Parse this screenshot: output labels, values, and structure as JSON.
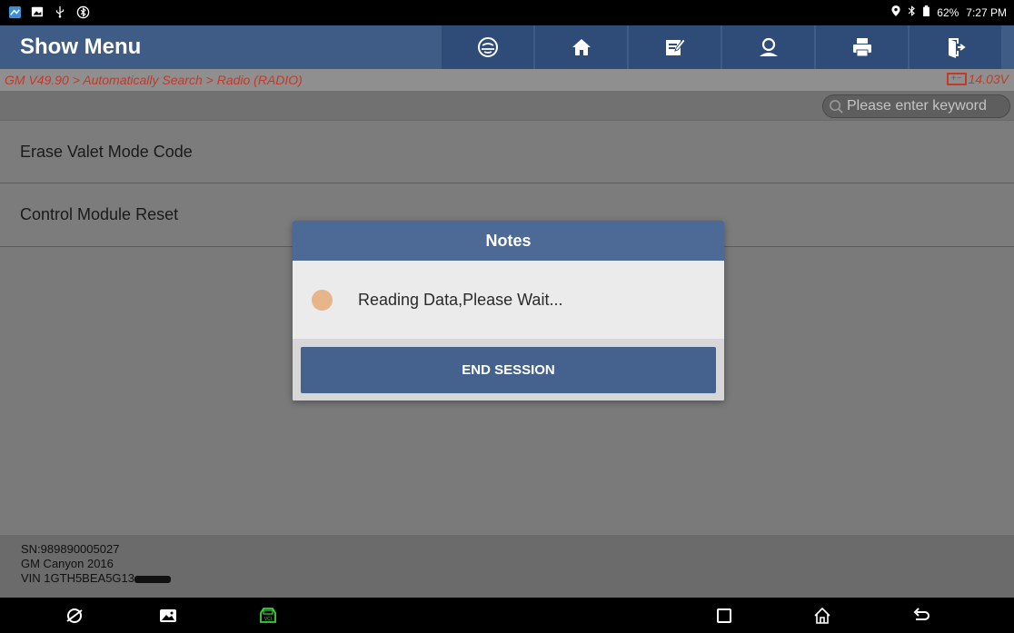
{
  "status_bar": {
    "left_icons": [
      "app-icon",
      "image-icon",
      "usb-icon",
      "bluetooth-settings-icon"
    ],
    "battery_percent": "62%",
    "time": "7:27 PM"
  },
  "header": {
    "title": "Show Menu",
    "toolbar": [
      "diagnose-icon",
      "home-icon",
      "edit-icon",
      "person-icon",
      "print-icon",
      "exit-icon"
    ]
  },
  "breadcrumb": {
    "path": "GM V49.90 > Automatically Search > Radio (RADIO)",
    "voltage": "14.03V"
  },
  "search": {
    "placeholder": "Please enter keyword"
  },
  "menu": {
    "items": [
      {
        "label": "Erase Valet Mode Code"
      },
      {
        "label": "Control Module Reset"
      }
    ]
  },
  "footer": {
    "sn": "SN:989890005027",
    "vehicle": "GM Canyon 2016",
    "vin": "VIN 1GTH5BEA5G13"
  },
  "dialog": {
    "title": "Notes",
    "message": "Reading Data,Please Wait...",
    "button_label": "END SESSION"
  },
  "colors": {
    "title_bar": "#3f5c86",
    "toolbar_button": "#2f4c78",
    "breadcrumb_text": "#c23a2a",
    "dialog_header": "#4d6a96",
    "dialog_button": "#45628f",
    "loading_dot": "#e8b489"
  }
}
